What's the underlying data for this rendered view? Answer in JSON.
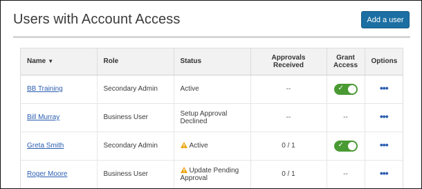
{
  "header": {
    "title": "Users with Account Access",
    "add_button_label": "Add a user"
  },
  "table": {
    "columns": [
      "Name",
      "Role",
      "Status",
      "Approvals Received",
      "Grant Access",
      "Options"
    ],
    "rows": [
      {
        "name": "BB Training",
        "role": "Secondary Admin",
        "status": "Active",
        "status_warning": false,
        "approvals": "--",
        "grant_access": "toggle-on",
        "grant_text": ""
      },
      {
        "name": "Bill Murray",
        "role": "Business User",
        "status": "Setup Approval Declined",
        "status_warning": false,
        "approvals": "--",
        "grant_access": "none",
        "grant_text": "--"
      },
      {
        "name": "Greta Smith",
        "role": "Secondary Admin",
        "status": "Active",
        "status_warning": true,
        "approvals": "0 / 1",
        "grant_access": "toggle-on",
        "grant_text": ""
      },
      {
        "name": "Roger Moore",
        "role": "Business User",
        "status": "Update Pending Approval",
        "status_warning": true,
        "approvals": "0 / 1",
        "grant_access": "none",
        "grant_text": "--"
      }
    ]
  },
  "icons": {
    "sort": "sort-desc-icon",
    "warning": "warning-icon",
    "toggle_check": "check-icon",
    "options": "more-horizontal-icon"
  },
  "colors": {
    "primary_button": "#1c6fa3",
    "toggle_on": "#4a9a33",
    "link": "#2a5db0",
    "warning": "#f0a30a"
  }
}
